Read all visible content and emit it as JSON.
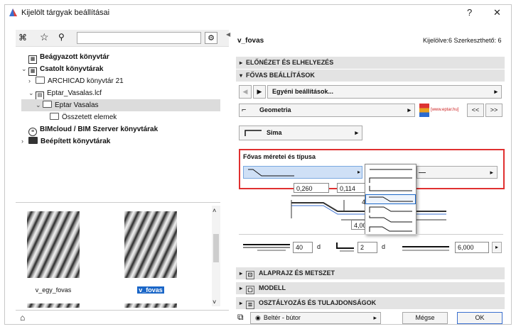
{
  "window": {
    "title": "Kijelölt tárgyak beállításai",
    "help": "?",
    "close": "✕"
  },
  "tree": [
    {
      "label": "Beágyazott könyvtár",
      "bold": true
    },
    {
      "label": "Csatolt könyvtárak",
      "bold": true
    },
    {
      "label": "ARCHICAD könyvtár 21",
      "bold": false
    },
    {
      "label": "Eptar_Vasalas.lcf",
      "bold": false
    },
    {
      "label": "Eptar Vasalas",
      "bold": false
    },
    {
      "label": "Összetett elemek",
      "bold": false
    },
    {
      "label": "BIMcloud / BIM Szerver könyvtárak",
      "bold": true
    },
    {
      "label": "Beépített könyvtárak",
      "bold": true
    }
  ],
  "thumbs": [
    {
      "label": "v_egy_fovas"
    },
    {
      "label": "v_fovas"
    }
  ],
  "header": {
    "name": "v_fovas",
    "status": "Kijelölve:6 Szerkeszthető: 6"
  },
  "sections": {
    "preview": "ELŐNÉZET ÉS ELHELYEZÉS",
    "main": "FŐVAS BEÁLLÍTÁSOK",
    "plan": "ALAPRAJZ ÉS METSZET",
    "model": "MODELL",
    "class": "OSZTÁLYOZÁS ÉS TULAJDONSÁGOK"
  },
  "custom_settings": "Egyéni beállítások...",
  "geometry": "Geometria",
  "brand": "[www.eptar.hu]",
  "nav_prev": "<<",
  "nav_next": ">>",
  "shape": "Sima",
  "size_type_label": "Fővas méretei és típusa",
  "dims": {
    "d1": "0,260",
    "d2": "0,114",
    "d3": "4",
    "d4": "4,00"
  },
  "bottom_fields": {
    "a": "40",
    "a_unit": "d",
    "b": "2",
    "b_unit": "d",
    "c": "6,000"
  },
  "layer": "Beltér - bútor",
  "cancel": "Mégse",
  "ok": "OK"
}
